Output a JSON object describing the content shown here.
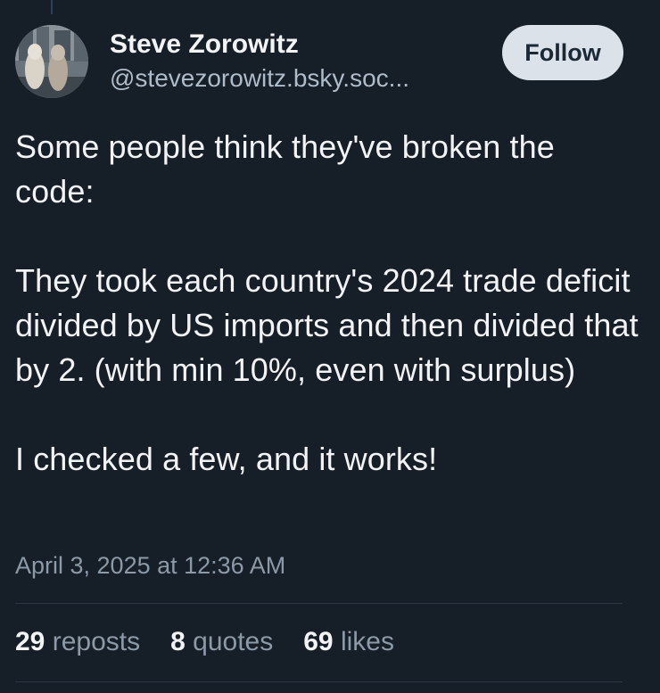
{
  "post": {
    "author": {
      "display_name": "Steve Zorowitz",
      "handle": "@stevezorowitz.bsky.soc..."
    },
    "follow_label": "Follow",
    "paragraphs": [
      "Some people think they've broken the code:",
      "They took each country's 2024 trade deficit divided by US imports and then divided that by 2. (with min 10%, even with surplus)",
      "I checked a few, and it works!"
    ],
    "timestamp": "April 3, 2025 at 12:36 AM",
    "stats": {
      "reposts": {
        "count": "29",
        "label": "reposts"
      },
      "quotes": {
        "count": "8",
        "label": "quotes"
      },
      "likes": {
        "count": "69",
        "label": "likes"
      }
    }
  },
  "colors": {
    "background": "#161e27",
    "text_primary": "#f1f3f5",
    "text_secondary": "#8c99a7",
    "follow_bg": "#dce2ea"
  }
}
